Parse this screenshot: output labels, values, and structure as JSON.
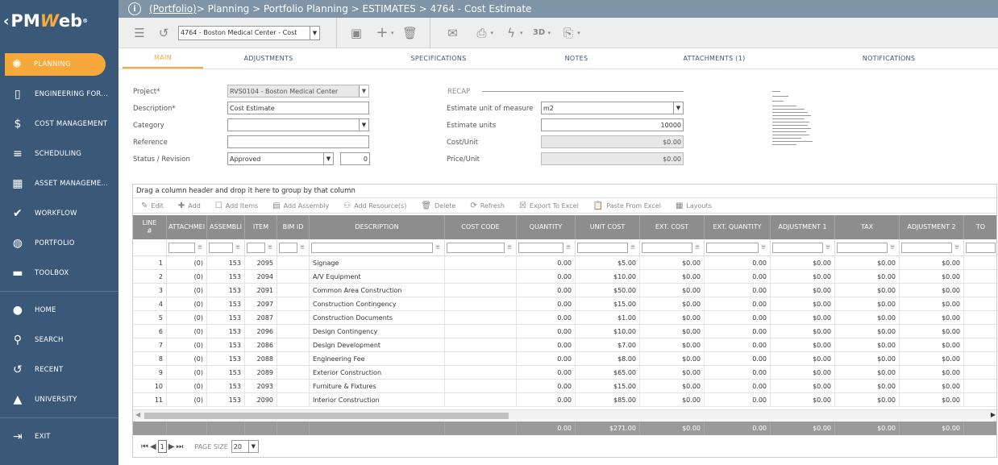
{
  "brand": {
    "logo_prefix": "PM",
    "logo_w": "W",
    "logo_suffix": "eb",
    "reg": "®"
  },
  "sidebar": {
    "items": [
      {
        "label": "PLANNING",
        "icon": "lightbulb-icon",
        "glyph": "✺",
        "active": true
      },
      {
        "label": "ENGINEERING FOR...",
        "icon": "document-icon",
        "glyph": "▯"
      },
      {
        "label": "COST MANAGEMENT",
        "icon": "dollar-icon",
        "glyph": "$"
      },
      {
        "label": "SCHEDULING",
        "icon": "gantt-icon",
        "glyph": "≡"
      },
      {
        "label": "ASSET MANAGEME...",
        "icon": "building-icon",
        "glyph": "▦"
      },
      {
        "label": "WORKFLOW",
        "icon": "check-icon",
        "glyph": "✔"
      },
      {
        "label": "PORTFOLIO",
        "icon": "globe-icon",
        "glyph": "◍"
      },
      {
        "label": "TOOLBOX",
        "icon": "toolbox-icon",
        "glyph": "▬"
      },
      {
        "label": "HOME",
        "icon": "user-icon",
        "glyph": "●"
      },
      {
        "label": "SEARCH",
        "icon": "search-icon",
        "glyph": "⚲"
      },
      {
        "label": "RECENT",
        "icon": "history-icon",
        "glyph": "↺"
      },
      {
        "label": "UNIVERSITY",
        "icon": "graduation-cap-icon",
        "glyph": "▲"
      },
      {
        "label": "EXIT",
        "icon": "exit-icon",
        "glyph": "⇥"
      }
    ]
  },
  "header": {
    "breadcrumb_link": "(Portfolio)",
    "breadcrumb_rest": " > Planning > Portfolio Planning > ESTIMATES > 4764 - Cost Estimate"
  },
  "toolbar": {
    "record_select": "4764 - Boston Medical Center - Cost"
  },
  "tabs": [
    {
      "label": "MAIN",
      "active": true
    },
    {
      "label": "ADJUSTMENTS"
    },
    {
      "label": "SPECIFICATIONS"
    },
    {
      "label": "NOTES"
    },
    {
      "label": "ATTACHMENTS (1)"
    },
    {
      "label": "NOTIFICATIONS"
    }
  ],
  "form": {
    "project_label": "Project*",
    "project_value": "RVS0104 - Boston Medical Center",
    "description_label": "Description*",
    "description_value": "Cost Estimate",
    "category_label": "Category",
    "category_value": "",
    "reference_label": "Reference",
    "reference_value": "",
    "status_label": "Status / Revision",
    "status_value": "Approved",
    "revision_value": "0",
    "recap_label": "RECAP",
    "uom_label": "Estimate unit of measure",
    "uom_value": "m2",
    "units_label": "Estimate units",
    "units_value": "10000",
    "cost_unit_label": "Cost/Unit",
    "cost_unit_value": "$0.00",
    "price_unit_label": "Price/Unit",
    "price_unit_value": "$0.00"
  },
  "grid": {
    "group_hint": "Drag a column header and drop it here to group by that column",
    "tools": [
      {
        "label": "Edit",
        "glyph": "✎",
        "name": "edit-button"
      },
      {
        "label": "Add",
        "glyph": "✚",
        "name": "add-button"
      },
      {
        "label": "Add Items",
        "glyph": "☐",
        "name": "add-items-button"
      },
      {
        "label": "Add Assembly",
        "glyph": "▤",
        "name": "add-assembly-button"
      },
      {
        "label": "Add Resource(s)",
        "glyph": "⚇",
        "name": "add-resources-button"
      },
      {
        "label": "Delete",
        "glyph": "🗑",
        "name": "delete-button"
      },
      {
        "label": "Refresh",
        "glyph": "⟳",
        "name": "refresh-button"
      },
      {
        "label": "Export To Excel",
        "glyph": "☒",
        "name": "export-excel-button"
      },
      {
        "label": "Paste From Excel",
        "glyph": "📋",
        "name": "paste-excel-button"
      },
      {
        "label": "Layouts",
        "glyph": "▦",
        "name": "layouts-button"
      }
    ],
    "columns": [
      "LINE\n#",
      "ATTACHMEI",
      "ASSEMBLI",
      "ITEM",
      "BIM ID",
      "DESCRIPTION",
      "COST CODE",
      "QUANTITY",
      "UNIT COST",
      "EXT. COST",
      "EXT. QUANTITY",
      "ADJUSTMENT 1",
      "TAX",
      "ADJUSTMENT 2",
      "TO"
    ],
    "rows": [
      [
        "1",
        "(0)",
        "153",
        "2095",
        "",
        "Signage",
        "",
        "0.00",
        "$5.00",
        "$0.00",
        "0.00",
        "$0.00",
        "$0.00",
        "$0.00",
        ""
      ],
      [
        "2",
        "(0)",
        "153",
        "2094",
        "",
        "A/V Equipment",
        "",
        "0.00",
        "$10.00",
        "$0.00",
        "0.00",
        "$0.00",
        "$0.00",
        "$0.00",
        ""
      ],
      [
        "3",
        "(0)",
        "153",
        "2091",
        "",
        "Common Area Construction",
        "",
        "0.00",
        "$50.00",
        "$0.00",
        "0.00",
        "$0.00",
        "$0.00",
        "$0.00",
        ""
      ],
      [
        "4",
        "(0)",
        "153",
        "2097",
        "",
        "Construction Contingency",
        "",
        "0.00",
        "$15.00",
        "$0.00",
        "0.00",
        "$0.00",
        "$0.00",
        "$0.00",
        ""
      ],
      [
        "5",
        "(0)",
        "153",
        "2087",
        "",
        "Construction Documents",
        "",
        "0.00",
        "$1.00",
        "$0.00",
        "0.00",
        "$0.00",
        "$0.00",
        "$0.00",
        ""
      ],
      [
        "6",
        "(0)",
        "153",
        "2096",
        "",
        "Design Contingency",
        "",
        "0.00",
        "$10.00",
        "$0.00",
        "0.00",
        "$0.00",
        "$0.00",
        "$0.00",
        ""
      ],
      [
        "7",
        "(0)",
        "153",
        "2086",
        "",
        "Design Development",
        "",
        "0.00",
        "$7.00",
        "$0.00",
        "0.00",
        "$0.00",
        "$0.00",
        "$0.00",
        ""
      ],
      [
        "8",
        "(0)",
        "153",
        "2088",
        "",
        "Engineering Fee",
        "",
        "0.00",
        "$8.00",
        "$0.00",
        "0.00",
        "$0.00",
        "$0.00",
        "$0.00",
        ""
      ],
      [
        "9",
        "(0)",
        "153",
        "2089",
        "",
        "Exterior Construction",
        "",
        "0.00",
        "$65.00",
        "$0.00",
        "0.00",
        "$0.00",
        "$0.00",
        "$0.00",
        ""
      ],
      [
        "10",
        "(0)",
        "153",
        "2093",
        "",
        "Furniture & Fixtures",
        "",
        "0.00",
        "$15.00",
        "$0.00",
        "0.00",
        "$0.00",
        "$0.00",
        "$0.00",
        ""
      ],
      [
        "11",
        "(0)",
        "153",
        "2090",
        "",
        "Interior Construction",
        "",
        "0.00",
        "$85.00",
        "$0.00",
        "0.00",
        "$0.00",
        "$0.00",
        "$0.00",
        ""
      ]
    ],
    "totals": [
      "",
      "",
      "",
      "",
      "",
      "",
      "",
      "0.00",
      "$271.00",
      "$0.00",
      "0.00",
      "$0.00",
      "$0.00",
      "$0.00",
      ""
    ],
    "pager": {
      "current": "1",
      "page_size_label": "PAGE SIZE",
      "page_size": "20"
    }
  }
}
